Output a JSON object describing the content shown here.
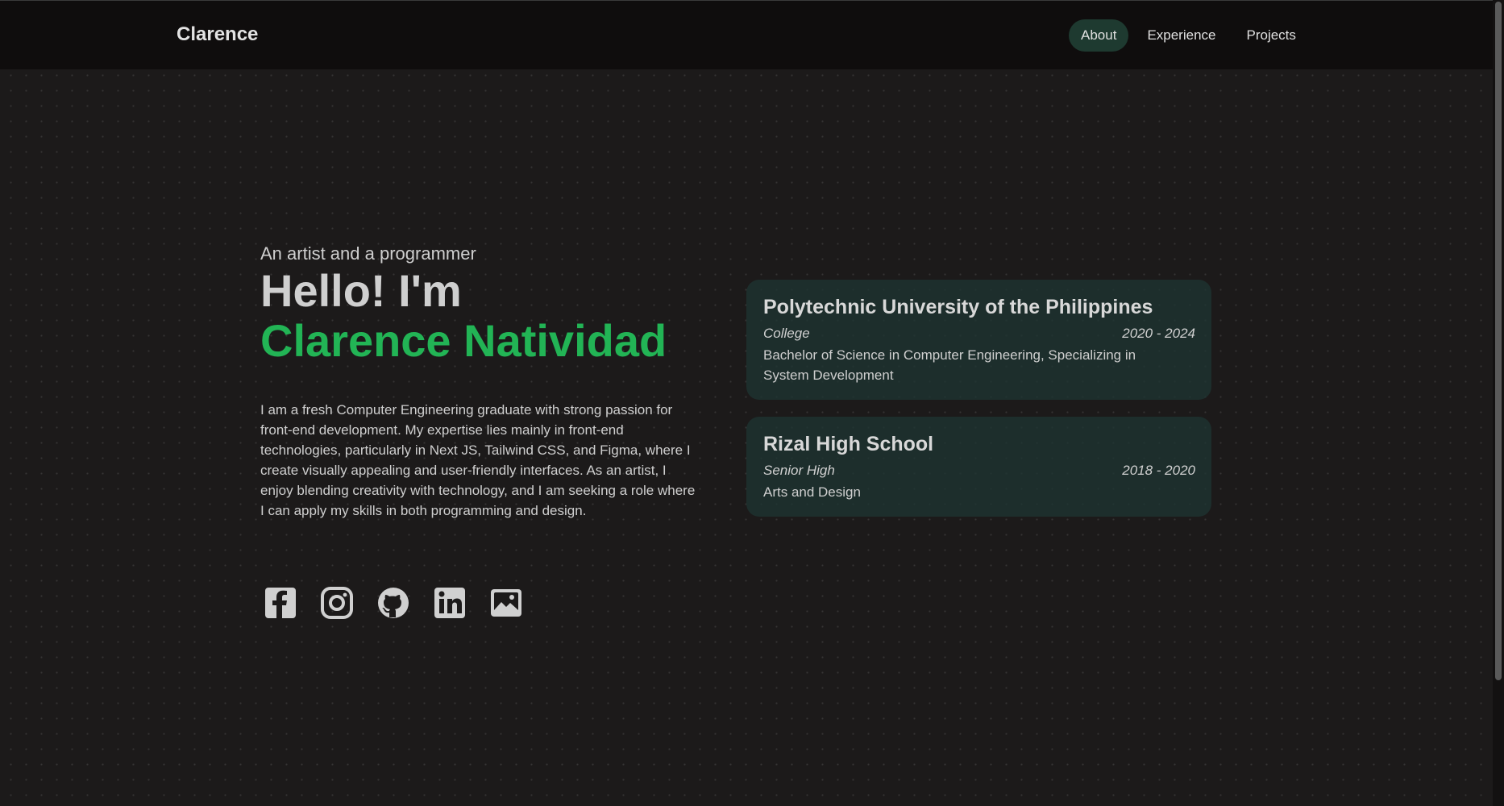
{
  "header": {
    "brand": "Clarence",
    "nav": [
      "About",
      "Experience",
      "Projects"
    ]
  },
  "hero": {
    "tagline": "An artist and a programmer",
    "greeting": "Hello! I'm",
    "name": "Clarence Natividad",
    "bio": "I am a fresh Computer Engineering graduate with strong passion for front-end development. My expertise lies mainly in front-end technologies, particularly in Next JS, Tailwind CSS, and Figma, where I create visually appealing and user-friendly interfaces. As an artist, I enjoy blending creativity with technology, and I am seeking a role where I can apply my skills in both programming and design."
  },
  "socials": [
    "facebook-icon",
    "instagram-icon",
    "github-icon",
    "linkedin-icon",
    "gallery-icon"
  ],
  "education": [
    {
      "school": "Polytechnic University of the Philippines",
      "level": "College",
      "years": "2020 - 2024",
      "description": "Bachelor of Science in Computer Engineering, Specializing in System Development"
    },
    {
      "school": "Rizal High School",
      "level": "Senior High",
      "years": "2018 - 2020",
      "description": "Arts and Design"
    }
  ],
  "colors": {
    "accent": "#22b455",
    "background": "#1c1a1a",
    "navbar": "#0f0d0d",
    "card": "#1e3432",
    "active_nav": "#1e3a30"
  }
}
